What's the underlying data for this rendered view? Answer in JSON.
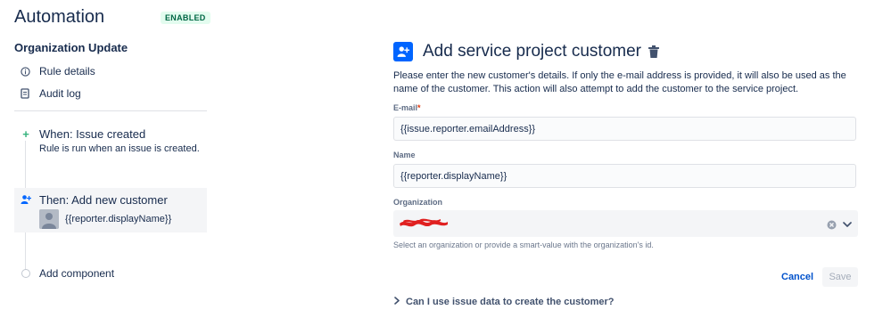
{
  "app": {
    "title": "Automation",
    "status_badge": "ENABLED"
  },
  "sidebar": {
    "rule_name": "Organization Update",
    "nav": [
      {
        "label": "Rule details",
        "icon": "info-icon"
      },
      {
        "label": "Audit log",
        "icon": "document-icon"
      }
    ],
    "steps": {
      "trigger": {
        "title": "When: Issue created",
        "subtitle": "Rule is run when an issue is created.",
        "icon": "plus-icon"
      },
      "action": {
        "title": "Then: Add new customer",
        "subtitle": "{{reporter.displayName}}",
        "icon": "add-customer-icon"
      },
      "add_component": "Add component"
    }
  },
  "panel": {
    "title": "Add service project customer",
    "description": "Please enter the new customer's details. If only the e-mail address is provided, it will also be used as the name of the customer. This action will also attempt to add the customer to the service project.",
    "fields": {
      "email": {
        "label": "E-mail",
        "required_marker": "*",
        "value": "{{issue.reporter.emailAddress}}"
      },
      "name": {
        "label": "Name",
        "value": "{{reporter.displayName}}"
      },
      "organization": {
        "label": "Organization",
        "help": "Select an organization or provide a smart-value with the organization's id."
      }
    },
    "buttons": {
      "cancel": "Cancel",
      "save": "Save"
    },
    "faq": "Can I use issue data to create the customer?"
  },
  "colors": {
    "accent": "#0052cc",
    "enabled": "#006644",
    "trigger_icon": "#36b37e",
    "redaction": "#e02020"
  }
}
